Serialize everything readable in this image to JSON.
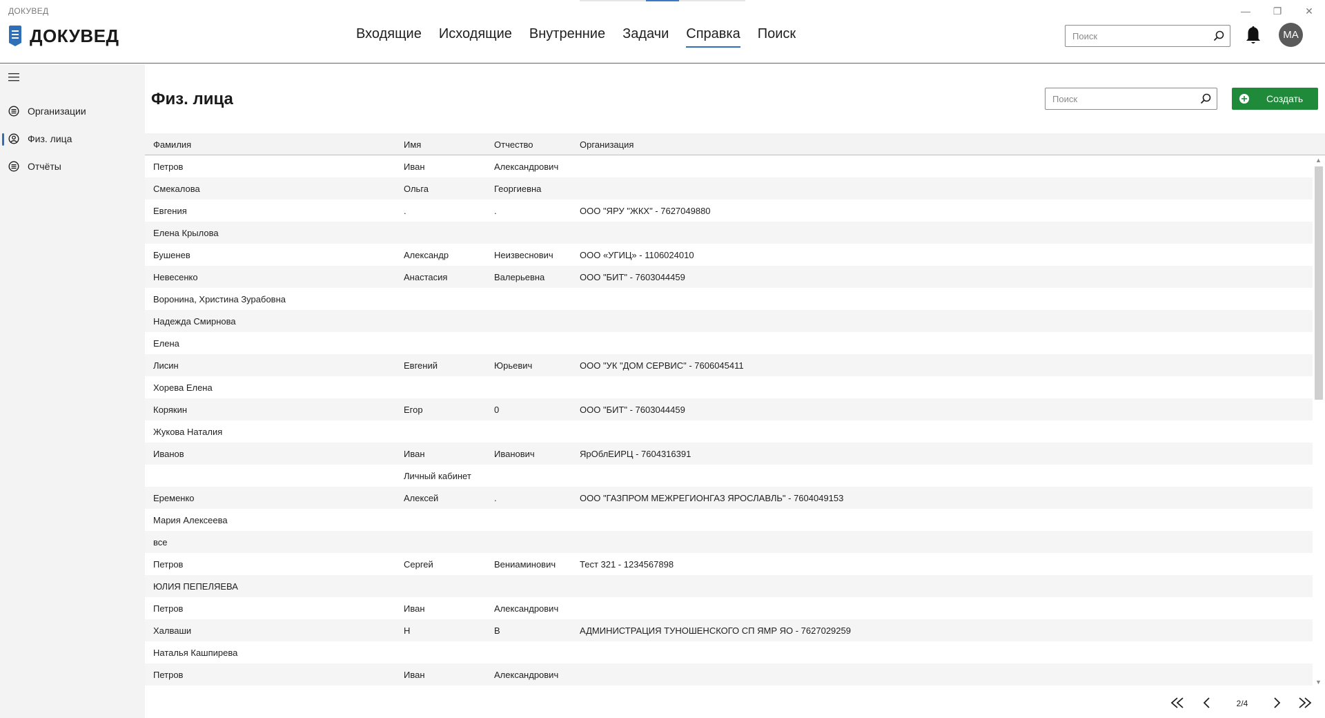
{
  "app": {
    "title": "ДОКУВЕД",
    "logo_text": "ДОКУВЕД"
  },
  "window_controls": {
    "minimize": "—",
    "maximize": "❐",
    "close": "✕"
  },
  "nav": {
    "items": [
      {
        "label": "Входящие"
      },
      {
        "label": "Исходящие"
      },
      {
        "label": "Внутренние"
      },
      {
        "label": "Задачи"
      },
      {
        "label": "Справка",
        "active": true
      },
      {
        "label": "Поиск"
      }
    ]
  },
  "header": {
    "search_placeholder": "Поиск",
    "avatar_initials": "МА"
  },
  "sidebar": {
    "items": [
      {
        "label": "Организации",
        "icon": "organization-icon"
      },
      {
        "label": "Физ. лица",
        "icon": "person-icon",
        "active": true
      },
      {
        "label": "Отчёты",
        "icon": "list-icon"
      }
    ]
  },
  "main": {
    "title": "Физ. лица",
    "search_placeholder": "Поиск",
    "create_label": "Создать"
  },
  "table": {
    "columns": [
      "Фамилия",
      "Имя",
      "Отчество",
      "Организация"
    ],
    "rows": [
      [
        "Петров",
        "Иван",
        "Александрович",
        ""
      ],
      [
        "Смекалова",
        "Ольга",
        "Георгиевна",
        ""
      ],
      [
        "Евгения",
        ".",
        ".",
        "ООО \"ЯРУ \"ЖКХ\" - 7627049880"
      ],
      [
        "Елена Крылова",
        "",
        "",
        ""
      ],
      [
        "Бушенев",
        "Александр",
        "Неизвеснович",
        "ООО «УГИЦ» - 1106024010"
      ],
      [
        "Невесенко",
        "Анастасия",
        "Валерьевна",
        "ООО \"БИТ\" - 7603044459"
      ],
      [
        "Воронина, Христина Зурабовна",
        "",
        "",
        ""
      ],
      [
        "Надежда Смирнова",
        "",
        "",
        ""
      ],
      [
        "Елена",
        "",
        "",
        ""
      ],
      [
        "Лисин",
        "Евгений",
        "Юрьевич",
        "ООО \"УК \"ДОМ СЕРВИС\" - 7606045411"
      ],
      [
        "Хорева Елена",
        "",
        "",
        ""
      ],
      [
        "Корякин",
        "Егор",
        "0",
        "ООО \"БИТ\" - 7603044459"
      ],
      [
        "Жукова Наталия",
        "",
        "",
        ""
      ],
      [
        "Иванов",
        "Иван",
        "Иванович",
        "ЯрОблЕИРЦ - 7604316391"
      ],
      [
        "",
        "Личный кабинет",
        "",
        ""
      ],
      [
        "Еременко",
        "Алексей",
        ".",
        "ООО \"ГАЗПРОМ МЕЖРЕГИОНГАЗ ЯРОСЛАВЛЬ\" - 7604049153"
      ],
      [
        "Мария Алексеева",
        "",
        "",
        ""
      ],
      [
        "все",
        "",
        "",
        ""
      ],
      [
        "Петров",
        "Сергей",
        "Вениаминович",
        "Тест 321 - 1234567898"
      ],
      [
        "ЮЛИЯ ПЕПЕЛЯЕВА",
        "",
        "",
        ""
      ],
      [
        "Петров",
        "Иван",
        "Александрович",
        ""
      ],
      [
        "Халваши",
        "Н",
        "В",
        "АДМИНИСТРАЦИЯ ТУНОШЕНСКОГО СП ЯМР ЯО - 7627029259"
      ],
      [
        "Наталья Кашпирева",
        "",
        "",
        ""
      ],
      [
        "Петров",
        "Иван",
        "Александрович",
        ""
      ]
    ]
  },
  "pager": {
    "current": "2/4"
  },
  "colors": {
    "accent": "#2f6fb8",
    "create_button": "#1f8a3a"
  }
}
